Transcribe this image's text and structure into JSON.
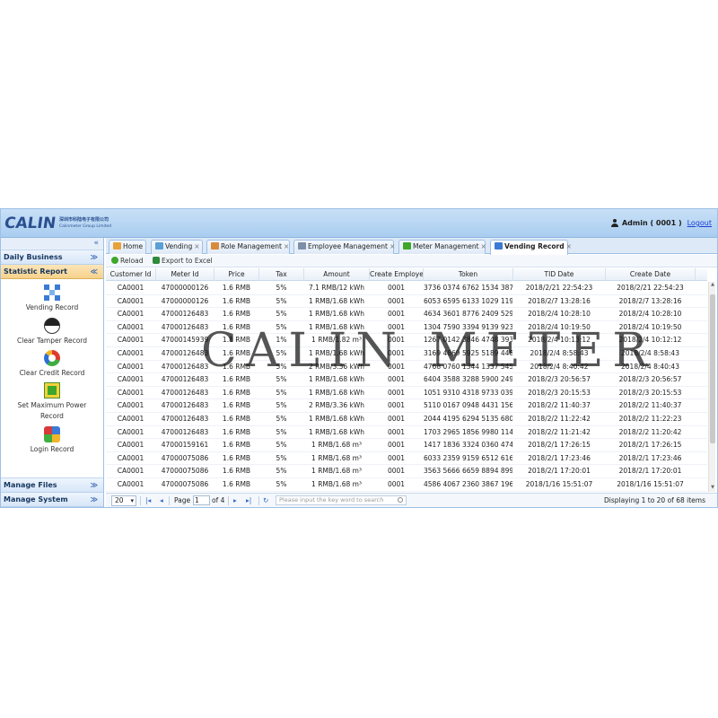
{
  "header": {
    "logo": "CALIN",
    "company_cn": "深圳市科陆电子有限公司",
    "company_en": "Calinmeter Group Limited",
    "user": "Admin ( 0001 )",
    "logout": "Logout"
  },
  "sidebar": {
    "collapse": "«",
    "sections": [
      {
        "title": "Daily Business",
        "chevron": "≫"
      },
      {
        "title": "Statistic Report",
        "chevron": "≪"
      },
      {
        "title": "Manage Files",
        "chevron": "≫"
      },
      {
        "title": "Manage System",
        "chevron": "≫"
      }
    ],
    "items": [
      {
        "label": "Vending Record",
        "icon": "vending-record-icon"
      },
      {
        "label": "Clear Tamper Record",
        "icon": "clear-tamper-icon"
      },
      {
        "label": "Clear Credit Record",
        "icon": "clear-credit-icon"
      },
      {
        "label": "Set Maximum Power",
        "label2": "Record",
        "icon": "set-max-power-icon"
      },
      {
        "label": "Login Record",
        "icon": "login-record-icon"
      }
    ]
  },
  "tabs": [
    {
      "label": "Home",
      "close": ""
    },
    {
      "label": "Vending",
      "close": "×"
    },
    {
      "label": "Role Management",
      "close": "×"
    },
    {
      "label": "Employee Management",
      "close": "×"
    },
    {
      "label": "Meter Management",
      "close": "×"
    },
    {
      "label": "Vending Record",
      "close": "×"
    }
  ],
  "toolbar": {
    "reload": "Reload",
    "export": "Export to Excel"
  },
  "columns": [
    "Customer Id",
    "Meter Id",
    "Price",
    "Tax",
    "Amount",
    "Create Employe",
    "Token",
    "TID Date",
    "Create Date"
  ],
  "rows": [
    [
      "CA0001",
      "47000000126",
      "1.6 RMB",
      "5%",
      "7.1 RMB/12 kWh",
      "0001",
      "3736 0374 6762 1534 387",
      "2018/2/21 22:54:23",
      "2018/2/21 22:54:23"
    ],
    [
      "CA0001",
      "47000000126",
      "1.6 RMB",
      "5%",
      "1 RMB/1.68 kWh",
      "0001",
      "6053 6595 6133 1029 119",
      "2018/2/7 13:28:16",
      "2018/2/7 13:28:16"
    ],
    [
      "CA0001",
      "47000126483",
      "1.6 RMB",
      "5%",
      "1 RMB/1.68 kWh",
      "0001",
      "4634 3601 8776 2409 529",
      "2018/2/4 10:28:10",
      "2018/2/4 10:28:10"
    ],
    [
      "CA0001",
      "47000126483",
      "1.6 RMB",
      "5%",
      "1 RMB/1.68 kWh",
      "0001",
      "1304 7590 3394 9139 923",
      "2018/2/4 10:19:50",
      "2018/2/4 10:19:50"
    ],
    [
      "CA0001",
      "47000145939",
      "1.8 RMB",
      "1%",
      "1 RMB/1.82 m³",
      "0001",
      "1267 0142 3846 4748 393",
      "2018/2/4 10:13:12",
      "2018/2/4 10:12:12"
    ],
    [
      "CA0001",
      "47000126483",
      "1.6 RMB",
      "5%",
      "1 RMB/1.68 kWh",
      "0001",
      "3169 4869 5925 5189 448",
      "2018/2/4 8:58:43",
      "2018/2/4 8:58:43"
    ],
    [
      "CA0001",
      "47000126483",
      "1.6 RMB",
      "5%",
      "2 RMB/3.36 kWh",
      "0001",
      "4768 0760 1344 1337 545",
      "2018/2/4 8:40:42",
      "2018/2/4 8:40:43"
    ],
    [
      "CA0001",
      "47000126483",
      "1.6 RMB",
      "5%",
      "1 RMB/1.68 kWh",
      "0001",
      "6404 3588 3288 5900 249",
      "2018/2/3 20:56:57",
      "2018/2/3 20:56:57"
    ],
    [
      "CA0001",
      "47000126483",
      "1.6 RMB",
      "5%",
      "1 RMB/1.68 kWh",
      "0001",
      "1051 9310 4318 9733 039",
      "2018/2/3 20:15:53",
      "2018/2/3 20:15:53"
    ],
    [
      "CA0001",
      "47000126483",
      "1.6 RMB",
      "5%",
      "2 RMB/3.36 kWh",
      "0001",
      "5110 0167 0948 4431 156",
      "2018/2/2 11:40:37",
      "2018/2/2 11:40:37"
    ],
    [
      "CA0001",
      "47000126483",
      "1.6 RMB",
      "5%",
      "1 RMB/1.68 kWh",
      "0001",
      "2044 4195 6294 5135 680",
      "2018/2/2 11:22:42",
      "2018/2/2 11:22:23"
    ],
    [
      "CA0001",
      "47000126483",
      "1.6 RMB",
      "5%",
      "1 RMB/1.68 kWh",
      "0001",
      "1703 2965 1856 9980 114",
      "2018/2/2 11:21:42",
      "2018/2/2 11:20:42"
    ],
    [
      "CA0001",
      "47000159161",
      "1.6 RMB",
      "5%",
      "1 RMB/1.68 m³",
      "0001",
      "1417 1836 3324 0360 474",
      "2018/2/1 17:26:15",
      "2018/2/1 17:26:15"
    ],
    [
      "CA0001",
      "47000075086",
      "1.6 RMB",
      "5%",
      "1 RMB/1.68 m³",
      "0001",
      "6033 2359 9159 6512 616",
      "2018/2/1 17:23:46",
      "2018/2/1 17:23:46"
    ],
    [
      "CA0001",
      "47000075086",
      "1.6 RMB",
      "5%",
      "1 RMB/1.68 m³",
      "0001",
      "3563 5666 6659 8894 899",
      "2018/2/1 17:20:01",
      "2018/2/1 17:20:01"
    ],
    [
      "CA0001",
      "47000075086",
      "1.6 RMB",
      "5%",
      "1 RMB/1.68 m³",
      "0001",
      "4586 4067 2360 3867 196",
      "2018/1/16 15:51:07",
      "2018/1/16 15:51:07"
    ]
  ],
  "pager": {
    "page_size": "20",
    "page_label": "Page",
    "page_value": "1",
    "of_label": "of 4",
    "search_placeholder": "Please input the key word to search",
    "info": "Displaying 1 to 20 of 68 items"
  },
  "watermark": "CALIN METER",
  "colors": {
    "header_bg": "#a9cdf0",
    "active_section": "#f7d28b",
    "link": "#1b3fd6"
  }
}
